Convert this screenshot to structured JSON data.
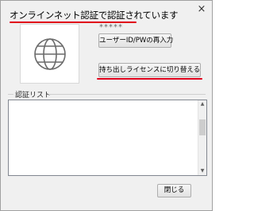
{
  "header": {
    "status_text": "オンラインネット認証で認証されています",
    "close_glyph": "×"
  },
  "license": {
    "icon": "globe-icon",
    "masked_id": "*****",
    "reenter_button_label": "ユーザーID/PWの再入力",
    "checkout_button_label": "持ち出しライセンスに切り替える"
  },
  "auth_list": {
    "group_label": "認証リスト",
    "items": []
  },
  "footer": {
    "close_button_label": "閉じる"
  },
  "colors": {
    "highlight_underline": "#e0001b",
    "dialog_background": "#f0f0f0"
  }
}
